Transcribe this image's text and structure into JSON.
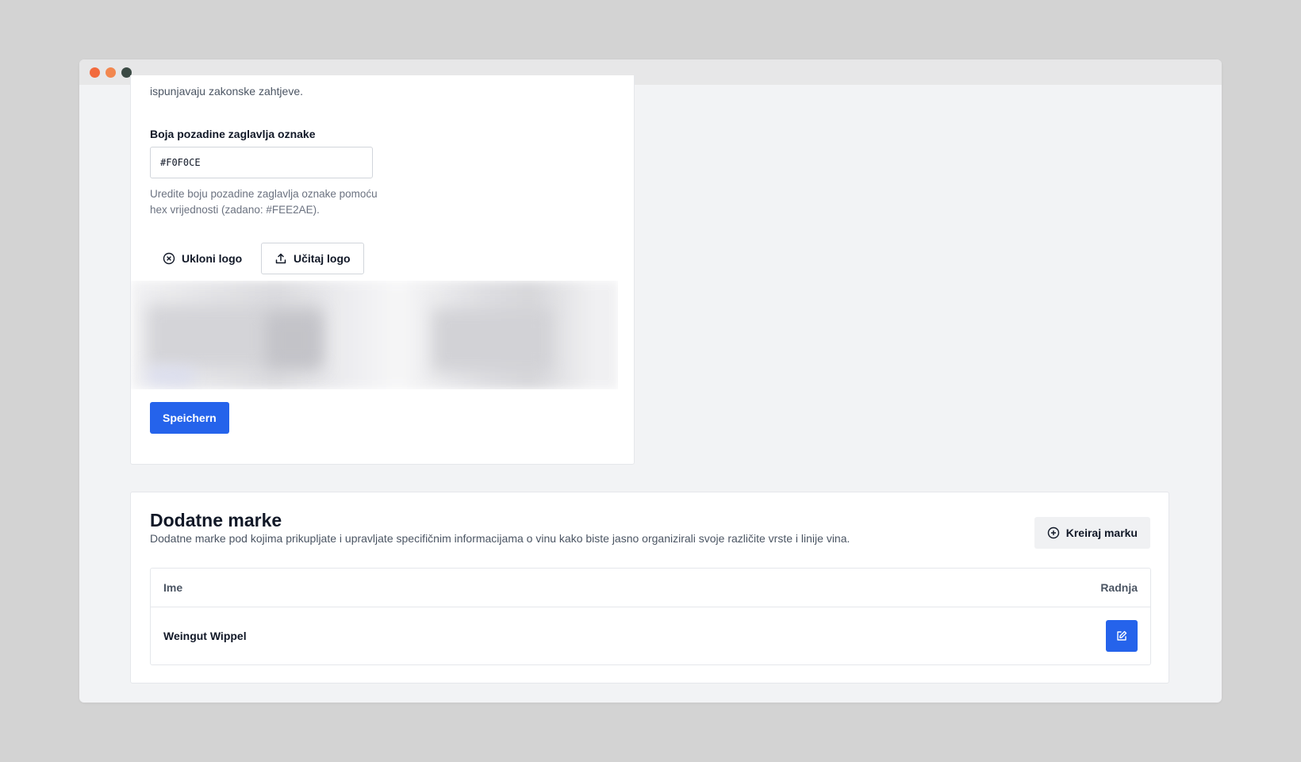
{
  "window": {
    "controls": [
      "close",
      "minimize",
      "maximize"
    ]
  },
  "label_settings": {
    "intro_text": "ispunjavaju zakonske zahtjeve.",
    "header_bg_label": "Boja pozadine zaglavlja oznake",
    "header_bg_value": "#F0F0CE",
    "header_bg_help": "Uredite boju pozadine zaglavlja oznake pomoću hex vrijednosti (zadano: #FEE2AE).",
    "remove_logo_label": "Ukloni logo",
    "upload_logo_label": "Učitaj logo",
    "save_label": "Speichern"
  },
  "brands": {
    "title": "Dodatne marke",
    "description": "Dodatne marke pod kojima prikupljate i upravljate specifičnim informacijama o vinu kako biste jasno organizirali svoje različite vrste i linije vina.",
    "create_label": "Kreiraj marku",
    "columns": {
      "name": "Ime",
      "action": "Radnja"
    },
    "rows": [
      {
        "name": "Weingut Wippel"
      }
    ]
  },
  "colors": {
    "primary": "#2563eb",
    "chat": "#ef3e1c"
  },
  "icons": {
    "remove": "circle-x-icon",
    "upload": "upload-icon",
    "create": "circle-plus-icon",
    "edit": "edit-icon",
    "chat": "chat-icon"
  }
}
